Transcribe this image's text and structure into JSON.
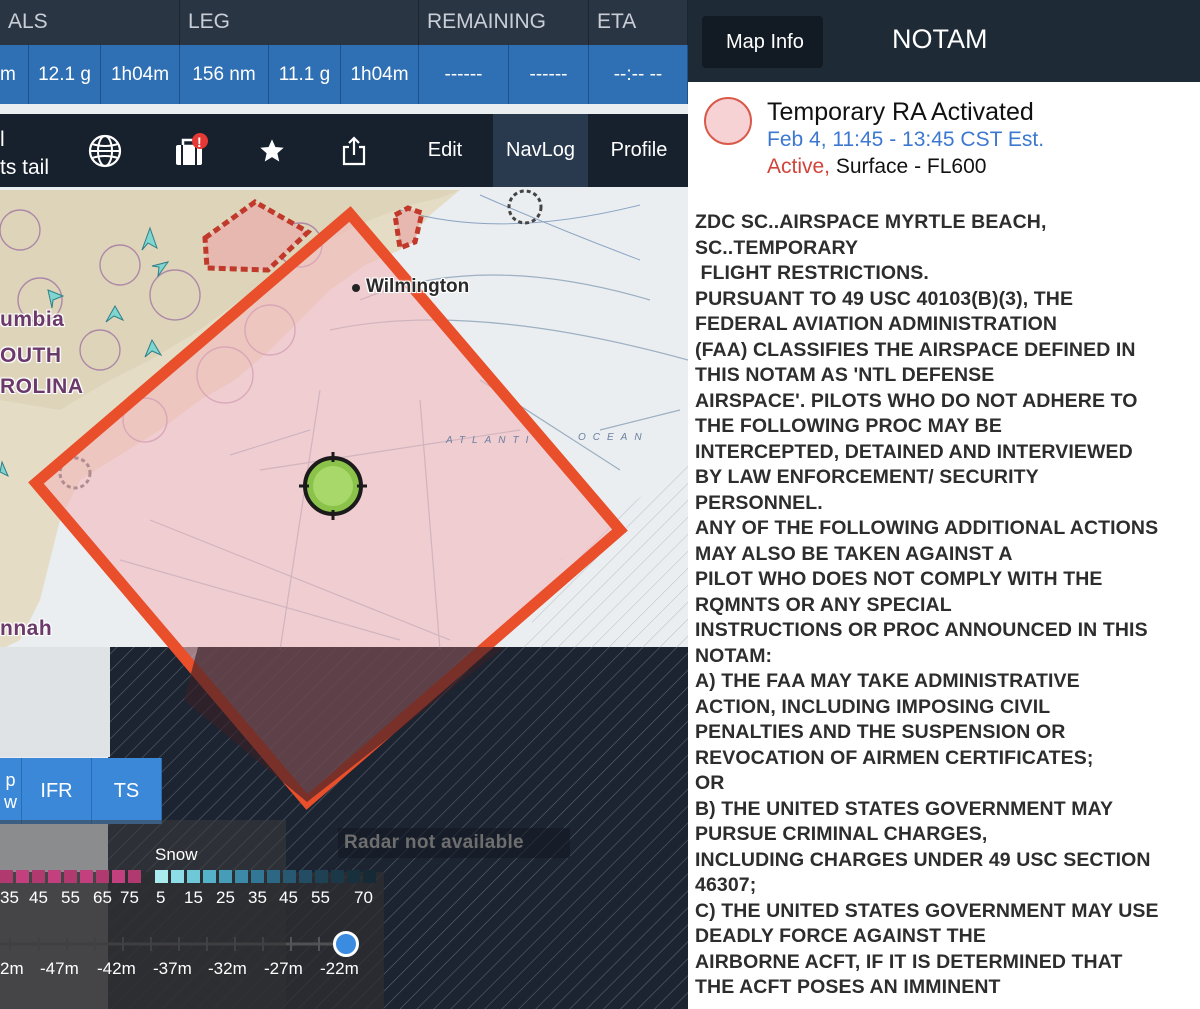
{
  "databar": {
    "headers": [
      "ALS",
      "LEG",
      "REMAINING",
      "ETA"
    ],
    "cells": [
      "m",
      "12.1 g",
      "1h04m",
      "156 nm",
      "11.1 g",
      "1h04m",
      "------",
      "------",
      "--:-- --"
    ]
  },
  "toolbar": {
    "tail_mark": "l",
    "tail_label": "ts tail",
    "edit_label": "Edit",
    "navlog_label": "NavLog",
    "profile_label": "Profile",
    "badge": "!"
  },
  "map": {
    "city_label": "Wilmington",
    "region_labels": [
      "umbia",
      "OUTH",
      "ROLINA",
      "nnah"
    ],
    "ocean_labels": [
      "ATLANTI",
      "OCEAN"
    ],
    "radar_message": "Radar not available",
    "colors": {
      "tfr_border": "#ea4f2c",
      "tfr_fill": "#f2b8bd",
      "center_marker": "#8bc34a"
    }
  },
  "layers": {
    "partial_top": "p",
    "partial_bottom": "w",
    "ifr_label": "IFR",
    "ts_label": "TS"
  },
  "legend": {
    "snow_title": "Snow",
    "rain_numbers": [
      "35",
      "45",
      "55",
      "65",
      "75"
    ],
    "snow_numbers": [
      "5",
      "15",
      "25",
      "35",
      "45",
      "55",
      "70"
    ],
    "timeline_labels": [
      "2m",
      "-47m",
      "-42m",
      "-37m",
      "-32m",
      "-27m",
      "-22m"
    ]
  },
  "panel": {
    "back_label": "Map Info",
    "title": "NOTAM",
    "notam_title": "Temporary RA Activated",
    "notam_time": "Feb 4, 11:45 - 13:45 CST Est.",
    "status_active": "Active,",
    "status_range": " Surface - FL600",
    "body": "ZDC SC..AIRSPACE MYRTLE BEACH,\nSC..TEMPORARY\n FLIGHT RESTRICTIONS.\nPURSUANT TO 49 USC 40103(B)(3), THE\nFEDERAL AVIATION ADMINISTRATION\n(FAA) CLASSIFIES THE AIRSPACE DEFINED IN\nTHIS NOTAM AS 'NTL DEFENSE\nAIRSPACE'. PILOTS WHO DO NOT ADHERE TO\nTHE FOLLOWING PROC MAY BE\nINTERCEPTED, DETAINED AND INTERVIEWED\nBY LAW ENFORCEMENT/ SECURITY\nPERSONNEL.\nANY OF THE FOLLOWING ADDITIONAL ACTIONS\nMAY ALSO BE TAKEN AGAINST A\nPILOT WHO DOES NOT COMPLY WITH THE\nRQMNTS OR ANY SPECIAL\nINSTRUCTIONS OR PROC ANNOUNCED IN THIS\nNOTAM:\nA) THE FAA MAY TAKE ADMINISTRATIVE\nACTION, INCLUDING IMPOSING CIVIL\nPENALTIES AND THE SUSPENSION OR\nREVOCATION OF AIRMEN CERTIFICATES;\nOR\nB) THE UNITED STATES GOVERNMENT MAY\nPURSUE CRIMINAL CHARGES,\nINCLUDING CHARGES UNDER 49 USC SECTION\n46307;\nC) THE UNITED STATES GOVERNMENT MAY USE\nDEADLY FORCE AGAINST THE\nAIRBORNE ACFT, IF IT IS DETERMINED THAT\nTHE ACFT POSES AN IMMINENT"
  }
}
